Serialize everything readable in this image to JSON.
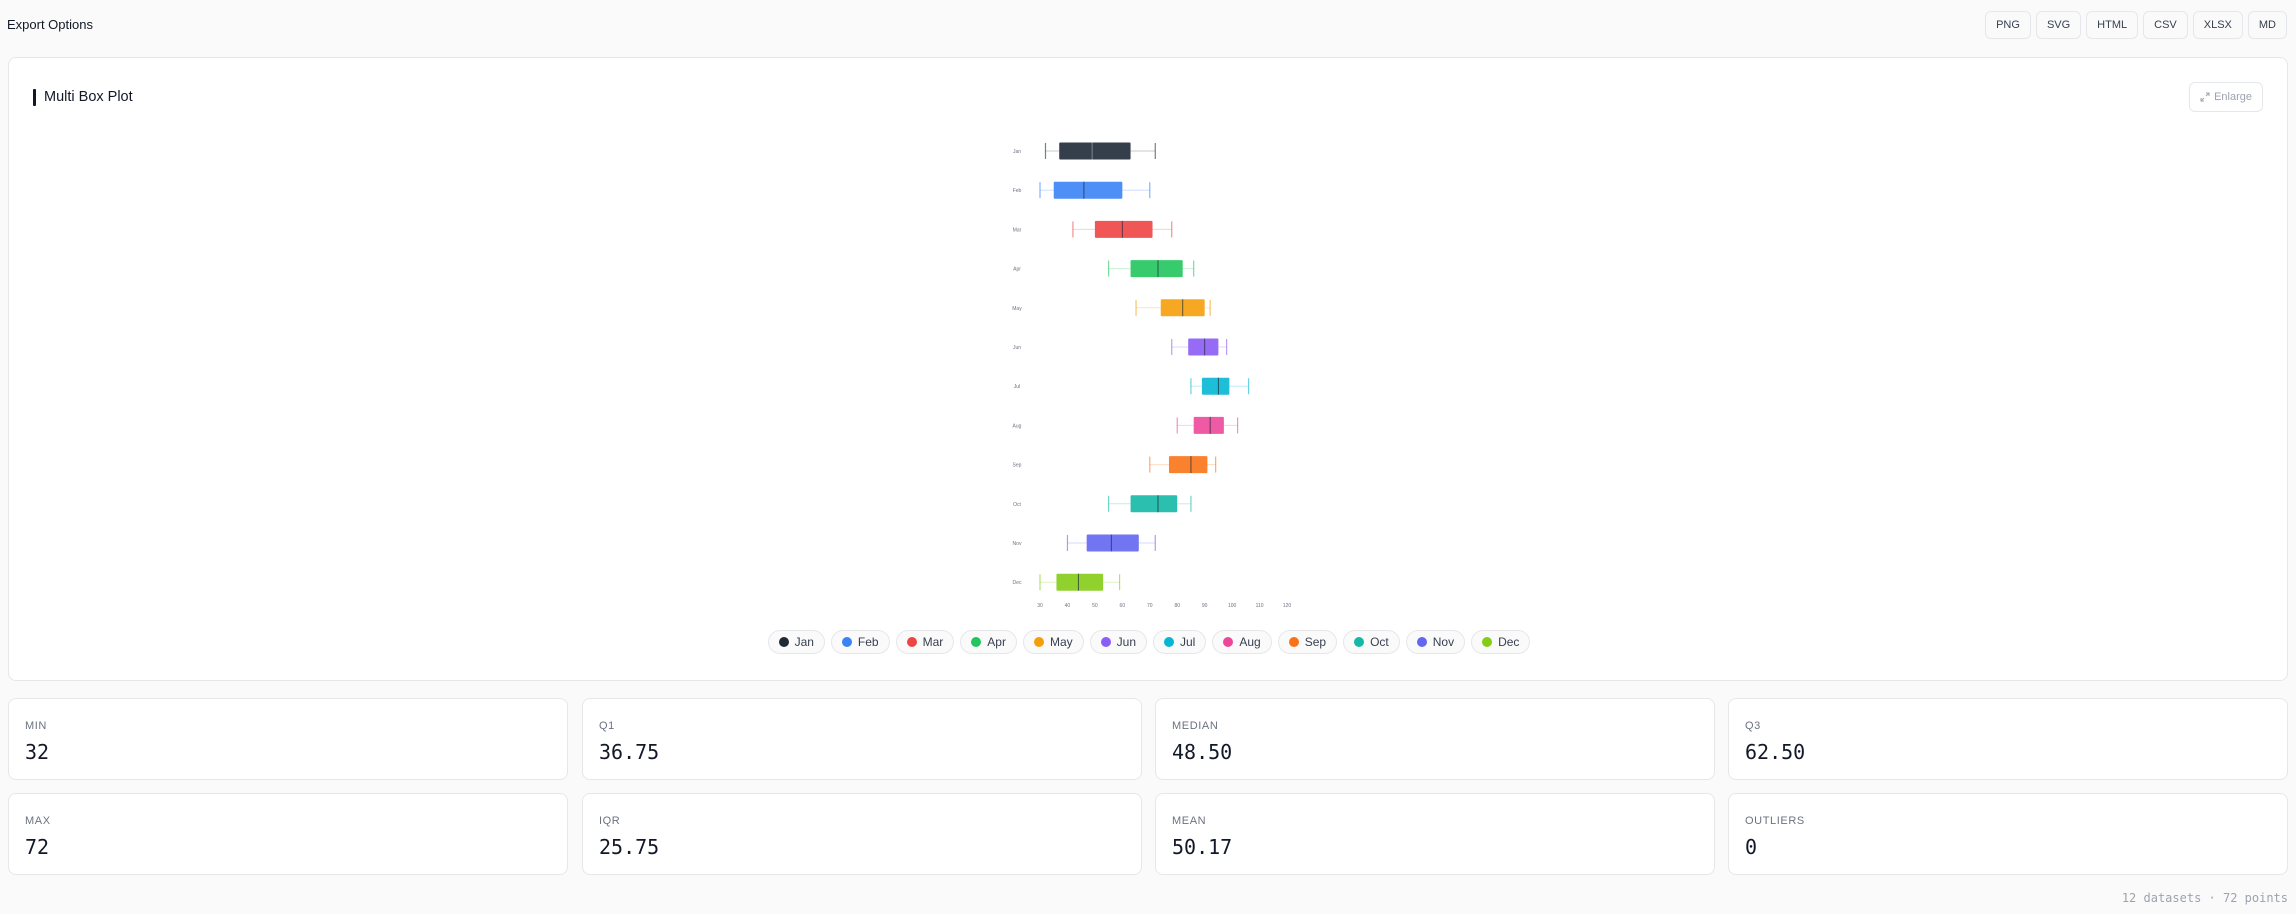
{
  "header": {
    "title": "Export Options"
  },
  "export_buttons": [
    "PNG",
    "SVG",
    "HTML",
    "CSV",
    "XLSX",
    "MD"
  ],
  "card": {
    "title": "Multi Box Plot",
    "enlarge_label": "Enlarge"
  },
  "chart_data": {
    "type": "boxplot",
    "orientation": "horizontal",
    "x_ticks": [
      30,
      40,
      50,
      60,
      70,
      80,
      90,
      100,
      110,
      120
    ],
    "xlim": [
      30,
      120
    ],
    "series": [
      {
        "name": "Jan",
        "color": "#1f2937",
        "min": 32,
        "q1": 37,
        "median": 49,
        "q3": 63,
        "max": 72
      },
      {
        "name": "Feb",
        "color": "#3b82f6",
        "min": 30,
        "q1": 35,
        "median": 46,
        "q3": 60,
        "max": 70
      },
      {
        "name": "Mar",
        "color": "#ef4444",
        "min": 42,
        "q1": 50,
        "median": 60,
        "q3": 71,
        "max": 78
      },
      {
        "name": "Apr",
        "color": "#22c55e",
        "min": 55,
        "q1": 63,
        "median": 73,
        "q3": 82,
        "max": 86
      },
      {
        "name": "May",
        "color": "#f59e0b",
        "min": 65,
        "q1": 74,
        "median": 82,
        "q3": 90,
        "max": 92
      },
      {
        "name": "Jun",
        "color": "#8b5cf6",
        "min": 78,
        "q1": 84,
        "median": 90,
        "q3": 95,
        "max": 98
      },
      {
        "name": "Jul",
        "color": "#06b6d4",
        "min": 85,
        "q1": 89,
        "median": 95,
        "q3": 99,
        "max": 106
      },
      {
        "name": "Aug",
        "color": "#ec4899",
        "min": 80,
        "q1": 86,
        "median": 92,
        "q3": 97,
        "max": 102
      },
      {
        "name": "Sep",
        "color": "#f97316",
        "min": 70,
        "q1": 77,
        "median": 85,
        "q3": 91,
        "max": 94
      },
      {
        "name": "Oct",
        "color": "#14b8a6",
        "min": 55,
        "q1": 63,
        "median": 73,
        "q3": 80,
        "max": 85
      },
      {
        "name": "Nov",
        "color": "#6366f1",
        "min": 40,
        "q1": 47,
        "median": 56,
        "q3": 66,
        "max": 72
      },
      {
        "name": "Dec",
        "color": "#84cc16",
        "min": 30,
        "q1": 36,
        "median": 44,
        "q3": 53,
        "max": 59
      }
    ]
  },
  "stats": [
    {
      "label": "MIN",
      "value": "32"
    },
    {
      "label": "Q1",
      "value": "36.75"
    },
    {
      "label": "MEDIAN",
      "value": "48.50"
    },
    {
      "label": "Q3",
      "value": "62.50"
    },
    {
      "label": "MAX",
      "value": "72"
    },
    {
      "label": "IQR",
      "value": "25.75"
    },
    {
      "label": "MEAN",
      "value": "50.17"
    },
    {
      "label": "OUTLIERS",
      "value": "0"
    }
  ],
  "footer": "12 datasets · 72 points"
}
